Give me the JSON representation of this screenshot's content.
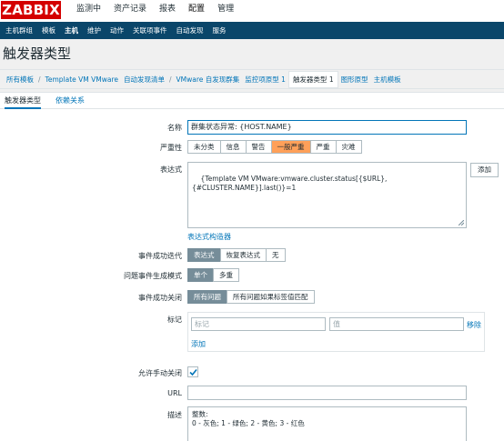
{
  "header": {
    "logo": "ZABBIX",
    "menu": [
      "监测中",
      "资产记录",
      "报表",
      "配置",
      "管理"
    ]
  },
  "subnav": [
    "主机群组",
    "模板",
    "主机",
    "维护",
    "动作",
    "关联项事件",
    "自动发现",
    "服务"
  ],
  "page_title": "触发器类型",
  "breadcrumb": {
    "items": [
      "所有模板",
      "Template VM VMware",
      "自动发现清单",
      "VMware 自发现群集",
      "监控项原型 1",
      "触发器类型 1",
      "图形原型",
      "主机模板"
    ],
    "separators": [
      "/",
      "/",
      "/"
    ]
  },
  "tabs": [
    "触发器类型",
    "依赖关系"
  ],
  "form": {
    "name_label": "名称",
    "name_value": "群集状态异常: {HOST.NAME}",
    "severity_label": "严重性",
    "severity_options": [
      "未分类",
      "信息",
      "警告",
      "一般严重",
      "严重",
      "灾难"
    ],
    "severity_selected_color": "#ffa059",
    "expression_label": "表达式",
    "expression_value": "{Template VM VMware:vmware.cluster.status[{$URL},\n{#CLUSTER.NAME}].last()}=1",
    "add_button": "添加",
    "expression_builder_link": "表达式构造器",
    "ok_event_label": "事件成功迭代",
    "ok_event_options": [
      "表达式",
      "恢复表达式",
      "无"
    ],
    "problem_mode_label": "问题事件生成模式",
    "problem_mode_options": [
      "单个",
      "多重"
    ],
    "ok_close_label": "事件成功关闭",
    "ok_close_options": [
      "所有问题",
      "所有问题如果标签值匹配"
    ],
    "tags_label": "标记",
    "tag_placeholder": "标记",
    "value_placeholder": "值",
    "remove_link": "移除",
    "add_tag_link": "添加",
    "manual_close_label": "允许手动关闭",
    "url_label": "URL",
    "url_value": "",
    "desc_label": "描述",
    "desc_value": "整数:\n0 - 灰色; 1 - 绿色; 2 - 黄色; 3 - 红色"
  },
  "colors": {
    "accent": "#0275b8",
    "nav_bg": "#0a466a",
    "logo_bg": "#d40000",
    "selected_dark": "#768d99"
  }
}
